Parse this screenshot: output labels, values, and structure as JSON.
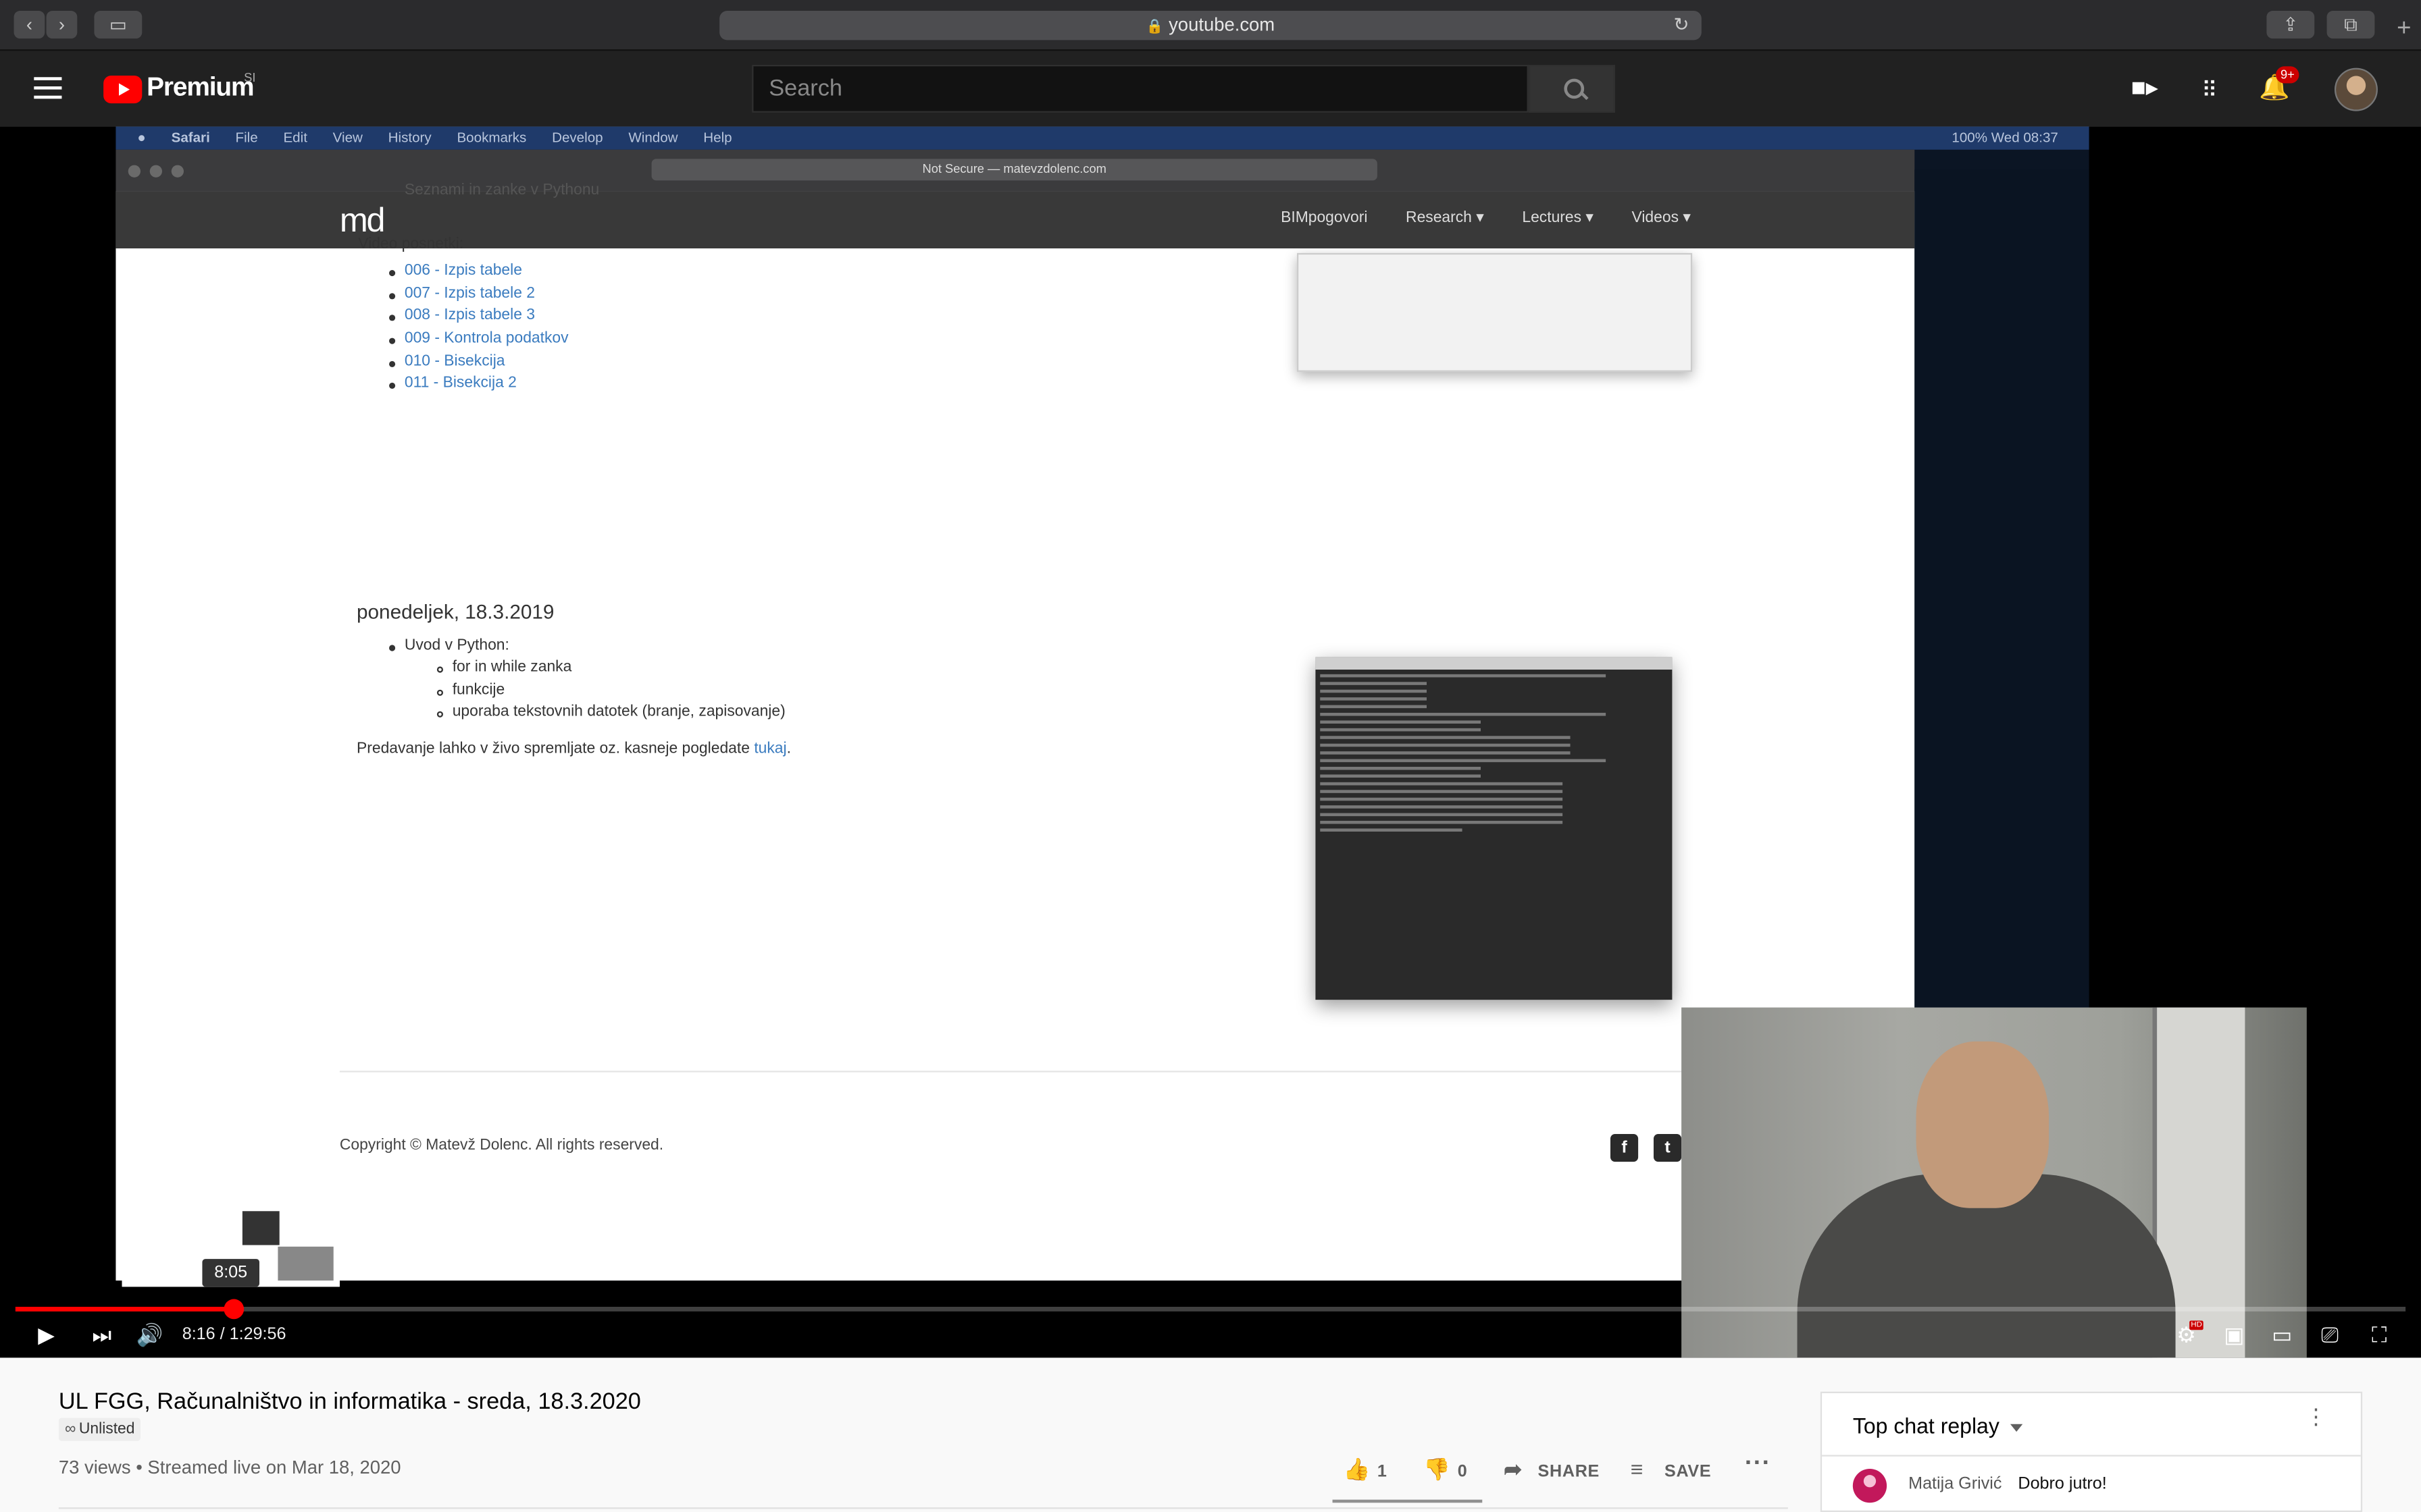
{
  "browser": {
    "url": "youtube.com",
    "lock": "🔒"
  },
  "youtube": {
    "brand": "Premium",
    "region": "SI",
    "search_placeholder": "Search",
    "notification_count": "9+"
  },
  "video_frame": {
    "mac_menu": [
      "Safari",
      "File",
      "Edit",
      "View",
      "History",
      "Bookmarks",
      "Develop",
      "Window",
      "Help"
    ],
    "mac_status": "100%  Wed 08:37",
    "inner_url": "Not Secure — matevzdolenc.com",
    "site_logo": "md",
    "site_nav": [
      "BIMpogovori",
      "Research ▾",
      "Lectures ▾",
      "Videos ▾"
    ],
    "top_item": "Seznami in zanke v Pythonu",
    "video_label": "Video posnetki:",
    "video_links": [
      "006 - Izpis tabele",
      "007 - Izpis tabele 2",
      "008 - Izpis tabele 3",
      "009 - Kontrola podatkov",
      "010 - Bisekcija",
      "011 - Bisekcija 2"
    ],
    "date_heading": "ponedeljek, 18.3.2019",
    "intro_item": "Uvod v Python:",
    "sub_items": [
      "for in while zanka",
      "funkcije",
      "uporaba tekstovnih datotek (branje, zapisovanje)"
    ],
    "live_text": "Predavanje lahko v živo spremljate oz. kasneje pogledate",
    "live_link": "tukaj",
    "copyright": "Copyright © Matevž Dolenc. All rights reserved."
  },
  "player": {
    "preview_time": "8:05",
    "current_time": "8:16",
    "duration": "1:29:56",
    "time_display": "8:16 / 1:29:56",
    "progress_fraction": 0.0908,
    "hd_badge": "HD"
  },
  "video": {
    "title": "UL FGG, Računalništvo in informatika - sreda, 18.3.2020",
    "visibility": "Unlisted",
    "views_line": "73 views • Streamed live on Mar 18, 2020",
    "likes": "1",
    "dislikes": "0",
    "share_label": "SHARE",
    "save_label": "SAVE"
  },
  "chat": {
    "title": "Top chat replay",
    "messages": [
      {
        "author": "Matija Grivić",
        "text": "Dobro jutro!"
      }
    ]
  }
}
